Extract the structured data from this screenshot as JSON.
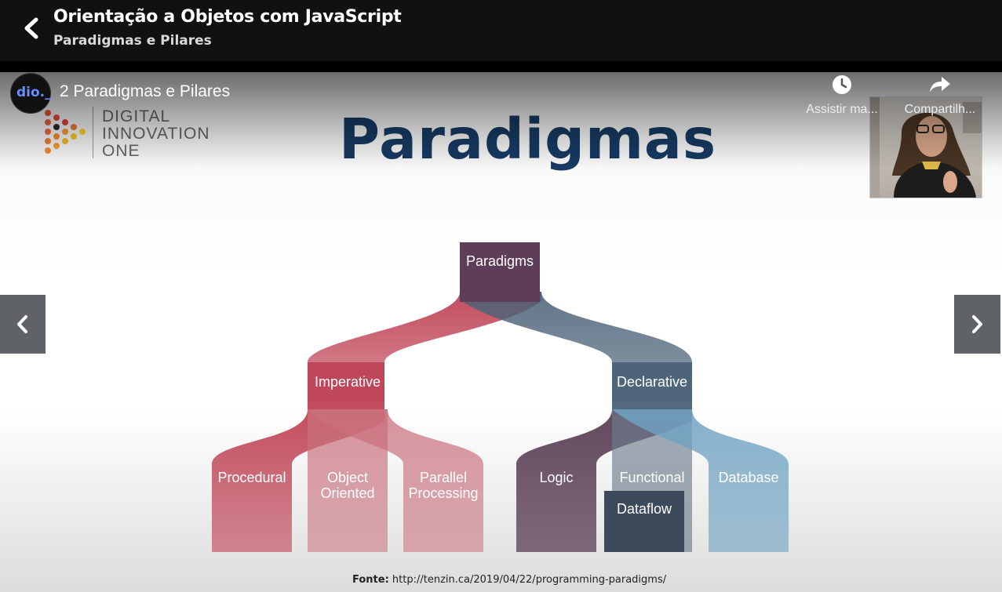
{
  "header": {
    "title": "Orientação a Objetos com JavaScript",
    "subtitle": "Paradigmas e Pilares"
  },
  "video": {
    "channel_avatar_text": "dio._",
    "title": "2 Paradigmas e Pilares",
    "actions": [
      {
        "icon": "clock-icon",
        "label": "Assistir ma..."
      },
      {
        "icon": "share-icon",
        "label": "Compartilh..."
      }
    ]
  },
  "slide": {
    "logo_lines": [
      "DIGITAL",
      "INNOVATION",
      "ONE"
    ],
    "heading": "Paradigmas",
    "diagram": {
      "root": "Paradigms",
      "level1": [
        "Imperative",
        "Declarative"
      ],
      "leaves": [
        "Procedural",
        "Object",
        "Oriented",
        "Parallel",
        "Processing",
        "Logic",
        "Functional",
        "Database",
        "Dataflow"
      ]
    },
    "source_label": "Fonte:",
    "source_url": "http://tenzin.ca/2019/04/22/programming-paradigms/"
  },
  "colors": {
    "imperative": "#bf4356",
    "declarative": "#4b6278",
    "database": "#6fa2c2",
    "heading": "#173a63"
  }
}
